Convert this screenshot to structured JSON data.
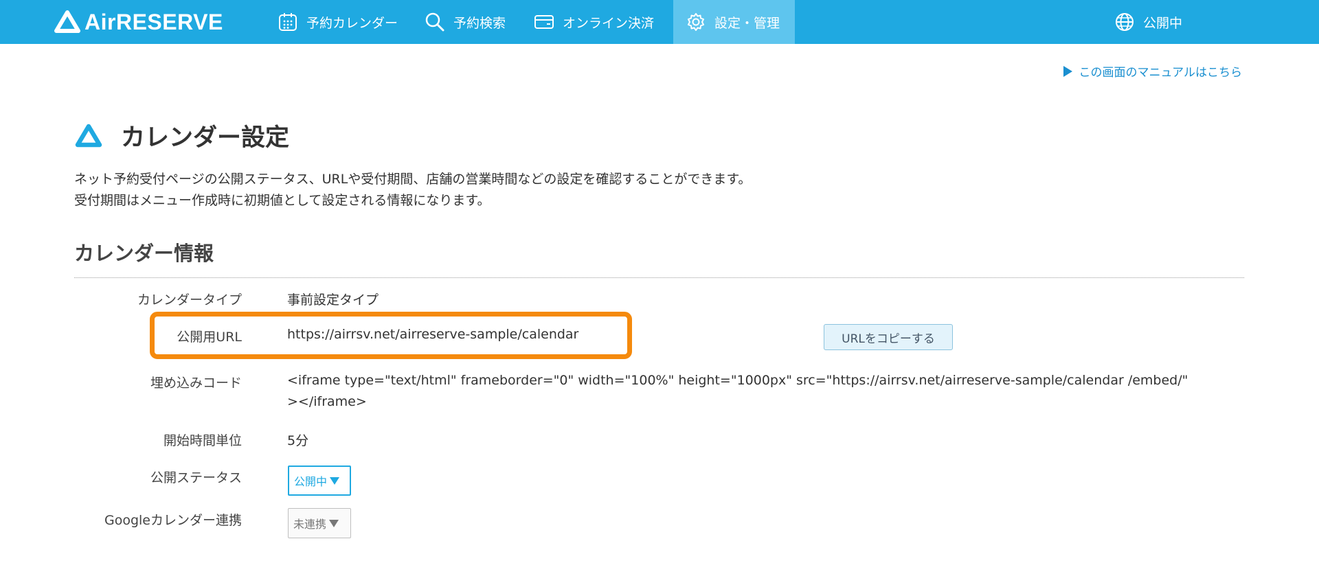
{
  "app": {
    "logo_text": "AirRESERVE"
  },
  "nav": {
    "calendar": "予約カレンダー",
    "search": "予約検索",
    "payment": "オンライン決済",
    "settings": "設定・管理",
    "public_status": "公開中"
  },
  "manual_link": "この画面のマニュアルはこちら",
  "page": {
    "title": "カレンダー設定",
    "description": [
      "ネット予約受付ページの公開ステータス、URLや受付期間、店舗の営業時間などの設定を確認することができます。",
      "受付期間はメニュー作成時に初期値として設定される情報になります。"
    ]
  },
  "section": {
    "title": "カレンダー情報"
  },
  "info": {
    "calendar_type": {
      "label": "カレンダータイプ",
      "value": "事前設定タイプ"
    },
    "public_url": {
      "label": "公開用URL",
      "value": "https://airrsv.net/airreserve-sample/calendar",
      "copy_button": "URLをコピーする"
    },
    "embed_code": {
      "label": "埋め込みコード",
      "value_line1": "<iframe type=\"text/html\" frameborder=\"0\" width=\"100%\" height=\"1000px\" src=\"https://airrsv.net/airreserve-sample/calendar /embed/\"",
      "value_line2": "></iframe>"
    },
    "start_time_unit": {
      "label": "開始時間単位",
      "value": "5分"
    },
    "public_status": {
      "label": "公開ステータス",
      "value": "公開中"
    },
    "google_calendar": {
      "label": "Googleカレンダー連携",
      "value": "未連携"
    }
  },
  "colors": {
    "header": "#1fa9e1",
    "header_active": "#5ec5ee",
    "highlight": "#f58a0d",
    "link": "#1a8fd0"
  }
}
